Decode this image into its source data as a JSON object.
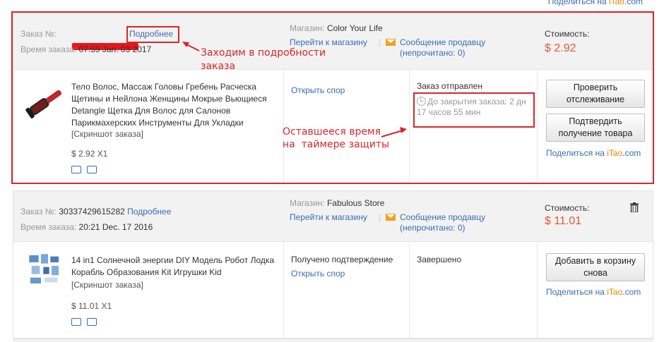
{
  "top_share": {
    "prefix": "Поделиться на ",
    "brand": "iTao",
    "suffix": ".com"
  },
  "orders": [
    {
      "order_label": "Заказ №:",
      "order_number": "",
      "details_link": "Подробнее",
      "time_label": "Время заказа:",
      "time_value": "07:59 Jan. 03 2017",
      "store_label": "Магазин:",
      "store_name": "Color Your Life",
      "store_link": "Перейти к магазину",
      "message_link": "Сообщение продавцу",
      "unread": "(непрочитано: 0)",
      "cost_label": "Стоимость:",
      "cost": "$ 2.92",
      "product_title": "Тело Волос, Массаж Головы Гребень Расческа Щетины и Нейлона Женщины Мокрые Вьющиеся Detangle Щетка Для Волос для Салонов Парикмахерских Инструменты Для Укладки",
      "snapshot": "[Скриншот заказа]",
      "price_qty": "$ 2.92 X1",
      "col3": "Открыть спор",
      "status": "Заказ отправлен",
      "timer": "До закрытия заказа: 2 дн 17 часов 55 мин",
      "btn1": "Проверить отслеживание",
      "btn2": "Подтвердить получение товара",
      "share": {
        "prefix": "Поделиться на ",
        "brand": "iTao",
        "suffix": ".com"
      }
    },
    {
      "order_label": "Заказ №:",
      "order_number": "30337429615282",
      "details_link": "Подробнее",
      "time_label": "Время заказа:",
      "time_value": "20:21 Dec. 17 2016",
      "store_label": "Магазин:",
      "store_name": "Fabulous Store",
      "store_link": "Перейти к магазину",
      "message_link": "Сообщение продавцу",
      "unread": "(непрочитано: 0)",
      "cost_label": "Стоимость:",
      "cost": "$ 11.01",
      "product_title": "14 in1 Солнечной энергии DIY Модель Робот Лодка Корабль Образования Kit Игрушки Kid",
      "snapshot": "[Скриншот заказа]",
      "price_qty": "$ 11.01 X1",
      "col3_line1": "Получено подтверждение",
      "col3": "Открыть спор",
      "status": "Завершено",
      "btn1": "Добавить в корзину снова",
      "share": {
        "prefix": "Поделиться на ",
        "brand": "iTao",
        "suffix": ".com"
      }
    }
  ],
  "annotations": {
    "details_note": "Заходим в подробности заказа",
    "timer_note_line1": "Оставшееся время",
    "timer_note_line2": "на  таймере защиты"
  },
  "colors": {
    "annotation_red": "#d9262a",
    "price_red": "#e05a3a",
    "link_blue": "#3a6cb4",
    "itao_orange": "#f08300"
  }
}
